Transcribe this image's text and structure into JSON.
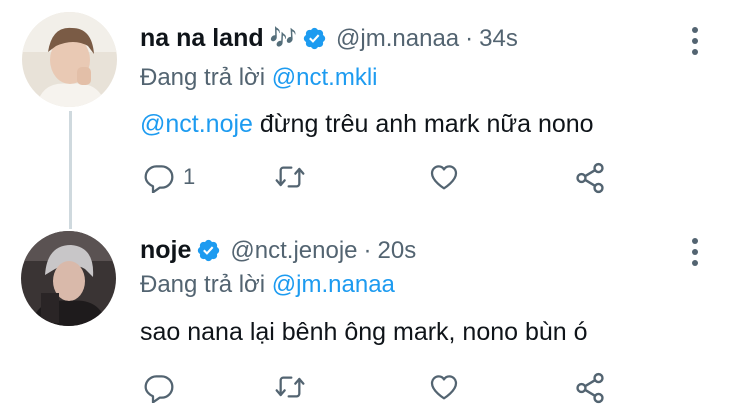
{
  "tweets": [
    {
      "display_name": "na na land",
      "name_emoji": "🎶",
      "handle": "@jm.nanaa",
      "separator": "·",
      "time": "34s",
      "reply_prefix": "Đang trả lời",
      "reply_to": "@nct.mkli",
      "mention": "@nct.noje",
      "text": " đừng trêu anh mark nữa nono",
      "reply_count": "1",
      "icons": [
        "more-icon",
        "reply-icon",
        "retweet-icon",
        "like-icon",
        "share-icon"
      ]
    },
    {
      "display_name": "noje",
      "handle": "@nct.jenoje",
      "separator": "·",
      "time": "20s",
      "reply_prefix": "Đang trả lời",
      "reply_to": "@jm.nanaa",
      "text": "sao nana lại bênh ông mark, nono bùn ó",
      "reply_count": "",
      "icons": [
        "more-icon",
        "reply-icon",
        "retweet-icon",
        "like-icon",
        "share-icon"
      ]
    }
  ],
  "colors": {
    "accent": "#1d9bf0",
    "secondary_text": "#536471",
    "primary_text": "#0f1419",
    "thread_line": "#cfd9de"
  }
}
